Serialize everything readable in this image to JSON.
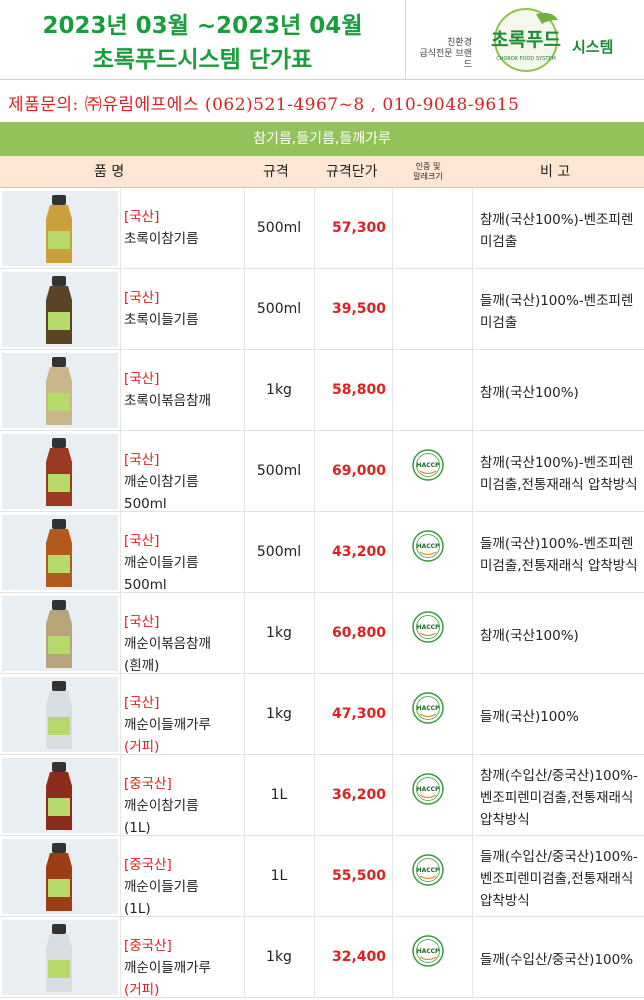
{
  "header": {
    "title_line1": "2023년 03월 ~2023년 04월",
    "title_line2": "초록푸드시스템 단가표",
    "brand_tagline_1": "친환경",
    "brand_tagline_2": "급식전문 브랜드",
    "brand_logo_text": "초록푸드",
    "brand_logo_subtext": "CHOROK FOOD SYSTEM",
    "brand_name": "시스템"
  },
  "contact": "제품문의: ㈜유림에프에스 (062)521-4967~8 , 010-9048-9615",
  "category": "참기름,들기름,들깨가루",
  "columns": {
    "product": "품 명",
    "spec": "규격",
    "price": "규격단가",
    "cert_1": "인증 및",
    "cert_2": "말레크기",
    "note": "비 고"
  },
  "haccp_label": "HACCP",
  "items": [
    {
      "origin": "[국산]",
      "name": "초록이참기름",
      "extra": "",
      "spec": "500ml",
      "price": "57,300",
      "haccp": false,
      "note": "참깨(국산100%)-벤조피렌미검출",
      "bottle": "#c9a13b"
    },
    {
      "origin": "[국산]",
      "name": "초록이들기름",
      "extra": "",
      "spec": "500ml",
      "price": "39,500",
      "haccp": false,
      "note": "들깨(국산)100%-벤조피렌미검출",
      "bottle": "#5a4326"
    },
    {
      "origin": "[국산]",
      "name": "초록이볶음참깨",
      "extra": "",
      "spec": "1kg",
      "price": "58,800",
      "haccp": false,
      "note": "참깨(국산100%)",
      "bottle": "#c9b68a"
    },
    {
      "origin": "[국산]",
      "name": "깨순이참기름",
      "extra": "500ml",
      "spec": "500ml",
      "price": "69,000",
      "haccp": true,
      "note": "참깨(국산100%)-벤조피렌미검출,전통재래식 압착방식",
      "bottle": "#9a3a22"
    },
    {
      "origin": "[국산]",
      "name": "깨순이들기름",
      "extra": "500ml",
      "spec": "500ml",
      "price": "43,200",
      "haccp": true,
      "note": "들깨(국산)100%-벤조피렌미검출,전통재래식 압착방식",
      "bottle": "#b25a1e"
    },
    {
      "origin": "[국산]",
      "name": "깨순이볶음참깨",
      "extra": "(흰깨)",
      "spec": "1kg",
      "price": "60,800",
      "haccp": true,
      "note": "참깨(국산100%)",
      "bottle": "#b8a47a"
    },
    {
      "origin": "[국산]",
      "name": "깨순이들깨가루",
      "extra": "(거피)",
      "spec": "1kg",
      "price": "47,300",
      "haccp": true,
      "note": "들깨(국산)100%",
      "bottle": "#d8dde2"
    },
    {
      "origin": "[중국산]",
      "name": "깨순이참기름",
      "extra": "(1L)",
      "spec": "1L",
      "price": "36,200",
      "haccp": true,
      "note": "참깨(수입산/중국산)100%-벤조피렌미검출,전통재래식 압착방식",
      "bottle": "#8b2c1c"
    },
    {
      "origin": "[중국산]",
      "name": "깨순이들기름",
      "extra": "(1L)",
      "spec": "1L",
      "price": "55,500",
      "haccp": true,
      "note": "들깨(수입산/중국산)100%-벤조피렌미검출,전통재래식 압착방식",
      "bottle": "#9c3d18"
    },
    {
      "origin": "[중국산]",
      "name": "깨순이들깨가루",
      "extra": "(거피)",
      "spec": "1kg",
      "price": "32,400",
      "haccp": true,
      "note": "들깨(수입산/중국산)100%",
      "bottle": "#d8dde2"
    }
  ]
}
